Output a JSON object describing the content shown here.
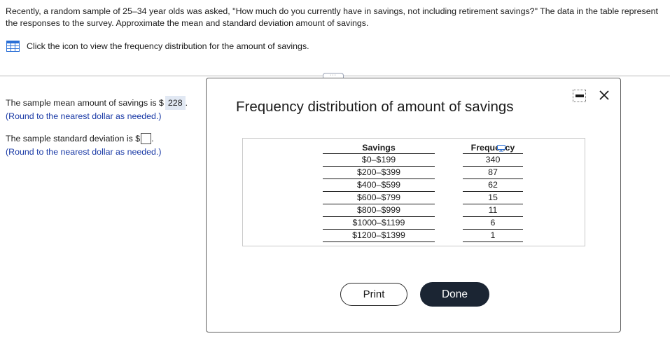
{
  "question": {
    "text": "Recently, a random sample of 25–34 year olds was asked, \"How much do you currently have in savings, not including retirement savings?\" The data in the table represent the responses to the survey. Approximate the mean and standard deviation amount of savings."
  },
  "frequency_link": {
    "icon": "table-icon",
    "label": "Click the icon to view the frequency distribution for the amount of savings."
  },
  "answers": {
    "mean": {
      "prefix": "The sample mean amount of savings is $",
      "value": "228",
      "suffix": ".",
      "hint": "(Round to the nearest dollar as needed.)"
    },
    "sd": {
      "prefix": "The sample standard deviation is $",
      "value": "",
      "suffix": ".",
      "hint": "(Round to the nearest dollar as needed.)"
    }
  },
  "modal": {
    "title": "Frequency distribution of amount of savings",
    "table": {
      "headers": [
        "Savings",
        "Frequency"
      ],
      "rows": [
        [
          "$0–$199",
          "340"
        ],
        [
          "$200–$399",
          "87"
        ],
        [
          "$400–$599",
          "62"
        ],
        [
          "$600–$799",
          "15"
        ],
        [
          "$800–$999",
          "11"
        ],
        [
          "$1000–$1199",
          "6"
        ],
        [
          "$1200–$1399",
          "1"
        ]
      ]
    },
    "buttons": {
      "print": "Print",
      "done": "Done"
    }
  },
  "colors": {
    "hint_text": "#1a3aa6",
    "mean_highlight": "#e1e8f3",
    "done_button": "#1b2533",
    "table_icon": "#2a6fd6"
  }
}
